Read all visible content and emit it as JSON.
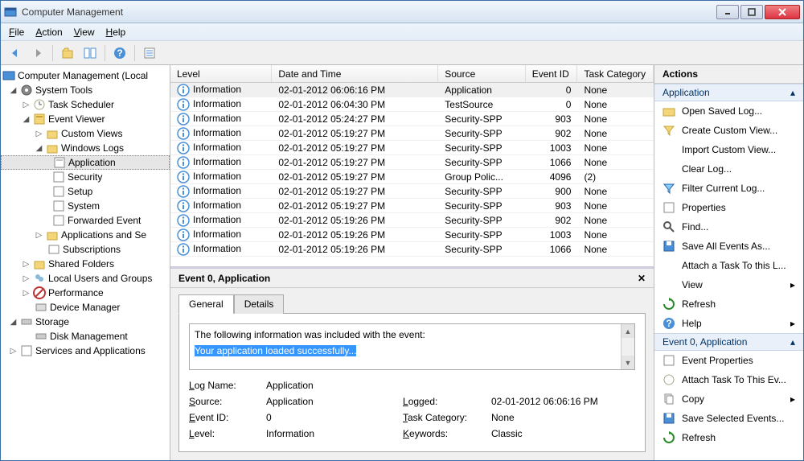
{
  "window": {
    "title": "Computer Management"
  },
  "menu": {
    "file": "File",
    "action": "Action",
    "view": "View",
    "help": "Help"
  },
  "tree": {
    "root": "Computer Management (Local",
    "systemTools": "System Tools",
    "taskScheduler": "Task Scheduler",
    "eventViewer": "Event Viewer",
    "customViews": "Custom Views",
    "windowsLogs": "Windows Logs",
    "application": "Application",
    "security": "Security",
    "setup": "Setup",
    "system": "System",
    "forwarded": "Forwarded Event",
    "appsServices": "Applications and Se",
    "subscriptions": "Subscriptions",
    "sharedFolders": "Shared Folders",
    "localUsers": "Local Users and Groups",
    "performance": "Performance",
    "deviceManager": "Device Manager",
    "storage": "Storage",
    "diskMgmt": "Disk Management",
    "servicesApps": "Services and Applications"
  },
  "grid": {
    "headers": {
      "level": "Level",
      "date": "Date and Time",
      "source": "Source",
      "eid": "Event ID",
      "cat": "Task Category"
    },
    "rows": [
      {
        "level": "Information",
        "date": "02-01-2012 06:06:16 PM",
        "source": "Application",
        "eid": "0",
        "cat": "None"
      },
      {
        "level": "Information",
        "date": "02-01-2012 06:04:30 PM",
        "source": "TestSource",
        "eid": "0",
        "cat": "None"
      },
      {
        "level": "Information",
        "date": "02-01-2012 05:24:27 PM",
        "source": "Security-SPP",
        "eid": "903",
        "cat": "None"
      },
      {
        "level": "Information",
        "date": "02-01-2012 05:19:27 PM",
        "source": "Security-SPP",
        "eid": "902",
        "cat": "None"
      },
      {
        "level": "Information",
        "date": "02-01-2012 05:19:27 PM",
        "source": "Security-SPP",
        "eid": "1003",
        "cat": "None"
      },
      {
        "level": "Information",
        "date": "02-01-2012 05:19:27 PM",
        "source": "Security-SPP",
        "eid": "1066",
        "cat": "None"
      },
      {
        "level": "Information",
        "date": "02-01-2012 05:19:27 PM",
        "source": "Group Polic...",
        "eid": "4096",
        "cat": "(2)"
      },
      {
        "level": "Information",
        "date": "02-01-2012 05:19:27 PM",
        "source": "Security-SPP",
        "eid": "900",
        "cat": "None"
      },
      {
        "level": "Information",
        "date": "02-01-2012 05:19:27 PM",
        "source": "Security-SPP",
        "eid": "903",
        "cat": "None"
      },
      {
        "level": "Information",
        "date": "02-01-2012 05:19:26 PM",
        "source": "Security-SPP",
        "eid": "902",
        "cat": "None"
      },
      {
        "level": "Information",
        "date": "02-01-2012 05:19:26 PM",
        "source": "Security-SPP",
        "eid": "1003",
        "cat": "None"
      },
      {
        "level": "Information",
        "date": "02-01-2012 05:19:26 PM",
        "source": "Security-SPP",
        "eid": "1066",
        "cat": "None"
      }
    ]
  },
  "detail": {
    "title": "Event 0, Application",
    "tabGeneral": "General",
    "tabDetails": "Details",
    "msgLine1": "The following information was included with the event:",
    "msgLine2": "Your application loaded successfully...",
    "logNameLbl": "Log Name:",
    "logName": "Application",
    "sourceLbl": "Source:",
    "source": "Application",
    "loggedLbl": "Logged:",
    "logged": "02-01-2012 06:06:16 PM",
    "eventIdLbl": "Event ID:",
    "eventId": "0",
    "taskCatLbl": "Task Category:",
    "taskCat": "None",
    "levelLbl": "Level:",
    "level": "Information",
    "keywordsLbl": "Keywords:",
    "keywords": "Classic"
  },
  "actions": {
    "header": "Actions",
    "sectionApp": "Application",
    "openSaved": "Open Saved Log...",
    "createCustom": "Create Custom View...",
    "importCustom": "Import Custom View...",
    "clearLog": "Clear Log...",
    "filterLog": "Filter Current Log...",
    "properties": "Properties",
    "find": "Find...",
    "saveAll": "Save All Events As...",
    "attachTask": "Attach a Task To this L...",
    "view": "View",
    "refresh": "Refresh",
    "help": "Help",
    "sectionEvent": "Event 0, Application",
    "eventProps": "Event Properties",
    "attachTask2": "Attach Task To This Ev...",
    "copy": "Copy",
    "saveSelected": "Save Selected Events...",
    "refresh2": "Refresh"
  }
}
